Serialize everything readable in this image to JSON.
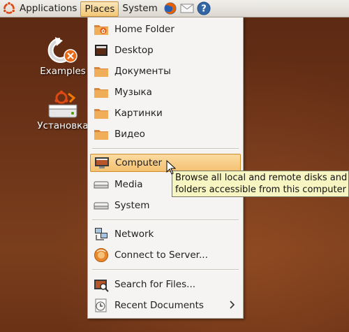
{
  "panel": {
    "applications_label": "Applications",
    "places_label": "Places",
    "system_label": "System",
    "icons": [
      "ubuntu-logo",
      "firefox-icon",
      "mail-icon",
      "help-icon"
    ]
  },
  "desktop": {
    "icons": [
      {
        "label": "Examples",
        "icon": "examples-icon"
      },
      {
        "label": "Установка",
        "icon": "installer-icon"
      }
    ]
  },
  "places_menu": {
    "items": [
      {
        "label": "Home Folder",
        "icon": "home-folder-icon"
      },
      {
        "label": "Desktop",
        "icon": "desktop-icon"
      },
      {
        "label": "Документы",
        "icon": "folder-icon"
      },
      {
        "label": "Музыка",
        "icon": "folder-icon"
      },
      {
        "label": "Картинки",
        "icon": "folder-icon"
      },
      {
        "label": "Видео",
        "icon": "folder-icon"
      },
      {
        "label": "Computer",
        "icon": "computer-icon",
        "highlighted": true
      },
      {
        "label": "Media",
        "icon": "drive-icon"
      },
      {
        "label": "System",
        "icon": "drive-icon"
      },
      {
        "label": "Network",
        "icon": "network-icon"
      },
      {
        "label": "Connect to Server...",
        "icon": "connect-server-icon"
      },
      {
        "label": "Search for Files...",
        "icon": "search-files-icon"
      },
      {
        "label": "Recent Documents",
        "icon": "recent-documents-icon",
        "submenu": true
      }
    ]
  },
  "tooltip": {
    "line1": "Browse all local and remote disks and",
    "line2": "folders accessible from this computer"
  },
  "colors": {
    "menu_highlight": "#f4c170",
    "tooltip_bg": "#f7f5c2",
    "desktop_bg": "#6b3318"
  }
}
